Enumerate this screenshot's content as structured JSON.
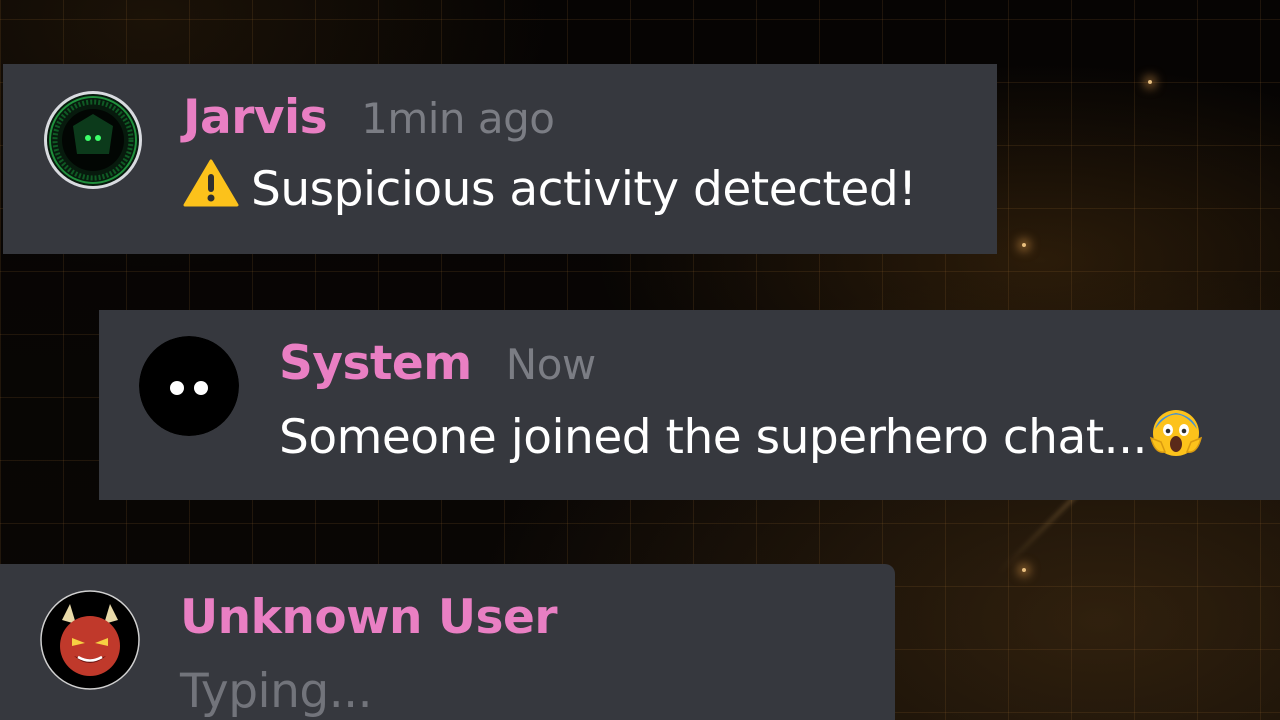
{
  "messages": [
    {
      "username": "Jarvis",
      "timestamp": "1min ago",
      "text": "Suspicious activity detected!",
      "prefix_icon": "warning-icon",
      "avatar_icon": "jarvis-robot-icon"
    },
    {
      "username": "System",
      "timestamp": "Now",
      "text": "Someone joined the superhero chat...",
      "suffix_icon": "screaming-face-icon",
      "avatar_icon": "shadow-eyes-icon"
    },
    {
      "username": "Unknown User",
      "status": "Typing...",
      "avatar_icon": "devil-face-icon"
    }
  ],
  "colors": {
    "username": "#e97fc3",
    "timestamp": "#7b7d84",
    "card": "#36383e",
    "message_text": "#ffffff",
    "typing": "#72747b"
  }
}
